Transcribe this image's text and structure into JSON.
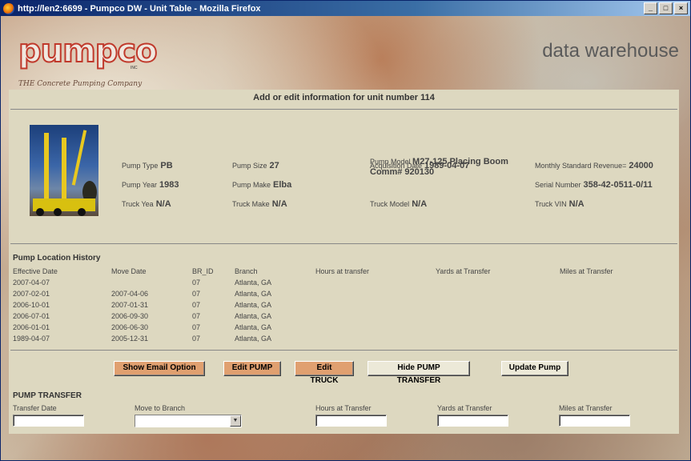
{
  "window": {
    "title": "http://len2:6699 - Pumpco DW - Unit Table - Mozilla Firefox",
    "minimize": "_",
    "maximize": "□",
    "close": "×"
  },
  "brand": {
    "logo": "pumpco",
    "inc": "INC",
    "tagline": "THE Concrete Pumping Company",
    "site_title": "data warehouse"
  },
  "heading": "Add or edit information for unit number 114",
  "unit": {
    "pump_type": {
      "label": "Pump Type",
      "value": "PB"
    },
    "pump_year": {
      "label": "Pump Year",
      "value": "1983"
    },
    "truck_year": {
      "label": "Truck Yea",
      "value": "N/A"
    },
    "pump_size": {
      "label": "Pump Size",
      "value": "27"
    },
    "pump_make": {
      "label": "Pump Make",
      "value": "Elba"
    },
    "truck_make": {
      "label": "Truck Make",
      "value": "N/A"
    },
    "acquisition_date": {
      "label": "Acquisition Date",
      "value": "1989-04-07"
    },
    "pump_model": {
      "label": "Pump Model",
      "value": "M27-125 Placing Boom Comm# 920130"
    },
    "truck_model": {
      "label": "Truck Model",
      "value": "N/A"
    },
    "monthly_revenue": {
      "label": "Monthly Standard Revenue=",
      "value": "24000"
    },
    "serial_number": {
      "label": "Serial Number",
      "value": "358-42-0511-0/11"
    },
    "truck_vin": {
      "label": "Truck VIN",
      "value": "N/A"
    }
  },
  "history": {
    "title": "Pump Location History",
    "columns": [
      "Effective Date",
      "Move Date",
      "BR_ID",
      "Branch",
      "Hours at transfer",
      "Yards at Transfer",
      "Miles at Transfer"
    ],
    "rows": [
      [
        "2007-04-07",
        "",
        "07",
        "Atlanta, GA",
        "",
        "",
        ""
      ],
      [
        "2007-02-01",
        "2007-04-06",
        "07",
        "Atlanta, GA",
        "",
        "",
        ""
      ],
      [
        "2006-10-01",
        "2007-01-31",
        "07",
        "Atlanta, GA",
        "",
        "",
        ""
      ],
      [
        "2006-07-01",
        "2006-09-30",
        "07",
        "Atlanta, GA",
        "",
        "",
        ""
      ],
      [
        "2006-01-01",
        "2006-06-30",
        "07",
        "Atlanta, GA",
        "",
        "",
        ""
      ],
      [
        "1989-04-07",
        "2005-12-31",
        "07",
        "Atlanta, GA",
        "",
        "",
        ""
      ]
    ]
  },
  "buttons": {
    "email": "Show Email Option",
    "edit_pump": "Edit PUMP",
    "edit_truck": "Edit TRUCK",
    "hide_transfer": "Hide PUMP TRANSFER",
    "update": "Update Pump"
  },
  "transfer": {
    "title": "PUMP TRANSFER",
    "transfer_date": {
      "label": "Transfer Date",
      "value": ""
    },
    "move_to_branch": {
      "label": "Move to Branch",
      "value": ""
    },
    "hours": {
      "label": "Hours at Transfer",
      "value": ""
    },
    "yards": {
      "label": "Yards at Transfer",
      "value": ""
    },
    "miles": {
      "label": "Miles at Transfer",
      "value": ""
    }
  }
}
